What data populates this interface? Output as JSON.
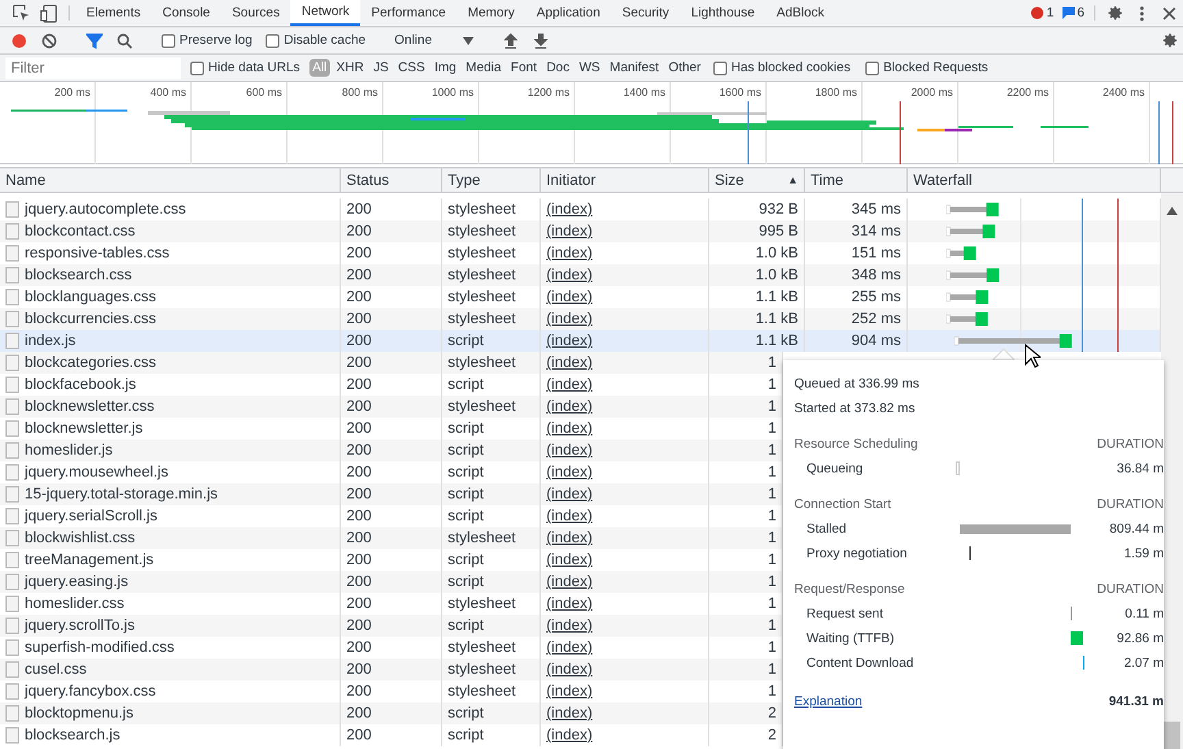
{
  "tabs": [
    {
      "label": "Elements",
      "selected": false
    },
    {
      "label": "Console",
      "selected": false
    },
    {
      "label": "Sources",
      "selected": false
    },
    {
      "label": "Network",
      "selected": true
    },
    {
      "label": "Performance",
      "selected": false
    },
    {
      "label": "Memory",
      "selected": false
    },
    {
      "label": "Application",
      "selected": false
    },
    {
      "label": "Security",
      "selected": false
    },
    {
      "label": "Lighthouse",
      "selected": false
    },
    {
      "label": "AdBlock",
      "selected": false
    }
  ],
  "badges": {
    "errors": "1",
    "messages": "6"
  },
  "toolbar": {
    "recording": true,
    "filter_on": true,
    "preserve_log": {
      "label": "Preserve log",
      "checked": false
    },
    "disable_cache": {
      "label": "Disable cache",
      "checked": false
    },
    "throttling": "Online"
  },
  "filter_bar": {
    "placeholder": "Filter",
    "hide_data_urls": {
      "label": "Hide data URLs",
      "checked": false
    },
    "types": [
      {
        "label": "All",
        "selected": true
      },
      {
        "label": "XHR",
        "selected": false
      },
      {
        "label": "JS",
        "selected": false
      },
      {
        "label": "CSS",
        "selected": false
      },
      {
        "label": "Img",
        "selected": false
      },
      {
        "label": "Media",
        "selected": false
      },
      {
        "label": "Font",
        "selected": false
      },
      {
        "label": "Doc",
        "selected": false
      },
      {
        "label": "WS",
        "selected": false
      },
      {
        "label": "Manifest",
        "selected": false
      },
      {
        "label": "Other",
        "selected": false
      }
    ],
    "has_blocked_cookies": {
      "label": "Has blocked cookies",
      "checked": false
    },
    "blocked_requests": {
      "label": "Blocked Requests",
      "checked": false
    }
  },
  "overview": {
    "ticks": [
      "200 ms",
      "400 ms",
      "600 ms",
      "800 ms",
      "1000 ms",
      "1200 ms",
      "1400 ms",
      "1600 ms",
      "1800 ms",
      "2000 ms",
      "2200 ms",
      "2400 ms"
    ]
  },
  "table": {
    "columns": [
      {
        "label": "Name"
      },
      {
        "label": "Status"
      },
      {
        "label": "Type"
      },
      {
        "label": "Initiator"
      },
      {
        "label": "Size",
        "sorted": true,
        "sort_glyph": "▲"
      },
      {
        "label": "Time"
      },
      {
        "label": "Waterfall"
      }
    ],
    "rows": [
      {
        "name": "jquery.autocomplete.css",
        "status": "200",
        "type": "stylesheet",
        "initiator": "(index)",
        "size": "932 B",
        "time": "345 ms",
        "selected": false
      },
      {
        "name": "blockcontact.css",
        "status": "200",
        "type": "stylesheet",
        "initiator": "(index)",
        "size": "995 B",
        "time": "314 ms",
        "selected": false
      },
      {
        "name": "responsive-tables.css",
        "status": "200",
        "type": "stylesheet",
        "initiator": "(index)",
        "size": "1.0 kB",
        "time": "151 ms",
        "selected": false
      },
      {
        "name": "blocksearch.css",
        "status": "200",
        "type": "stylesheet",
        "initiator": "(index)",
        "size": "1.0 kB",
        "time": "348 ms",
        "selected": false
      },
      {
        "name": "blocklanguages.css",
        "status": "200",
        "type": "stylesheet",
        "initiator": "(index)",
        "size": "1.1 kB",
        "time": "255 ms",
        "selected": false
      },
      {
        "name": "blockcurrencies.css",
        "status": "200",
        "type": "stylesheet",
        "initiator": "(index)",
        "size": "1.1 kB",
        "time": "252 ms",
        "selected": false
      },
      {
        "name": "index.js",
        "status": "200",
        "type": "script",
        "initiator": "(index)",
        "size": "1.1 kB",
        "time": "904 ms",
        "selected": true
      },
      {
        "name": "blockcategories.css",
        "status": "200",
        "type": "stylesheet",
        "initiator": "(index)",
        "size": "1",
        "selected": false
      },
      {
        "name": "blockfacebook.js",
        "status": "200",
        "type": "script",
        "initiator": "(index)",
        "size": "1",
        "selected": false
      },
      {
        "name": "blocknewsletter.css",
        "status": "200",
        "type": "stylesheet",
        "initiator": "(index)",
        "size": "1",
        "selected": false
      },
      {
        "name": "blocknewsletter.js",
        "status": "200",
        "type": "script",
        "initiator": "(index)",
        "size": "1",
        "selected": false
      },
      {
        "name": "homeslider.js",
        "status": "200",
        "type": "script",
        "initiator": "(index)",
        "size": "1",
        "selected": false
      },
      {
        "name": "jquery.mousewheel.js",
        "status": "200",
        "type": "script",
        "initiator": "(index)",
        "size": "1",
        "selected": false
      },
      {
        "name": "15-jquery.total-storage.min.js",
        "status": "200",
        "type": "script",
        "initiator": "(index)",
        "size": "1",
        "selected": false
      },
      {
        "name": "jquery.serialScroll.js",
        "status": "200",
        "type": "script",
        "initiator": "(index)",
        "size": "1",
        "selected": false
      },
      {
        "name": "blockwishlist.css",
        "status": "200",
        "type": "stylesheet",
        "initiator": "(index)",
        "size": "1",
        "selected": false
      },
      {
        "name": "treeManagement.js",
        "status": "200",
        "type": "script",
        "initiator": "(index)",
        "size": "1",
        "selected": false
      },
      {
        "name": "jquery.easing.js",
        "status": "200",
        "type": "script",
        "initiator": "(index)",
        "size": "1",
        "selected": false
      },
      {
        "name": "homeslider.css",
        "status": "200",
        "type": "stylesheet",
        "initiator": "(index)",
        "size": "1",
        "selected": false
      },
      {
        "name": "jquery.scrollTo.js",
        "status": "200",
        "type": "script",
        "initiator": "(index)",
        "size": "1",
        "selected": false
      },
      {
        "name": "superfish-modified.css",
        "status": "200",
        "type": "stylesheet",
        "initiator": "(index)",
        "size": "1",
        "selected": false
      },
      {
        "name": "cusel.css",
        "status": "200",
        "type": "stylesheet",
        "initiator": "(index)",
        "size": "1",
        "selected": false
      },
      {
        "name": "jquery.fancybox.css",
        "status": "200",
        "type": "stylesheet",
        "initiator": "(index)",
        "size": "1",
        "selected": false
      },
      {
        "name": "blocktopmenu.js",
        "status": "200",
        "type": "script",
        "initiator": "(index)",
        "size": "2",
        "selected": false
      },
      {
        "name": "blocksearch.js",
        "status": "200",
        "type": "script",
        "initiator": "(index)",
        "size": "2",
        "selected": false
      }
    ]
  },
  "timing_popup": {
    "queued": "Queued at 336.99 ms",
    "started": "Started at 373.82 ms",
    "sections": [
      {
        "title": "Resource Scheduling",
        "duration_label": "DURATION",
        "phases": [
          {
            "label": "Queueing",
            "kind": "queue",
            "value": "36.84 m"
          }
        ]
      },
      {
        "title": "Connection Start",
        "duration_label": "DURATION",
        "phases": [
          {
            "label": "Stalled",
            "kind": "stalled",
            "value": "809.44 m"
          },
          {
            "label": "Proxy negotiation",
            "kind": "proxy",
            "value": "1.59 m"
          }
        ]
      },
      {
        "title": "Request/Response",
        "duration_label": "DURATION",
        "phases": [
          {
            "label": "Request sent",
            "kind": "sent",
            "value": "0.11 m"
          },
          {
            "label": "Waiting (TTFB)",
            "kind": "waiting",
            "value": "92.86 m"
          },
          {
            "label": "Content Download",
            "kind": "download",
            "value": "2.07 m"
          }
        ]
      }
    ],
    "explanation": "Explanation",
    "total": "941.31 m"
  }
}
